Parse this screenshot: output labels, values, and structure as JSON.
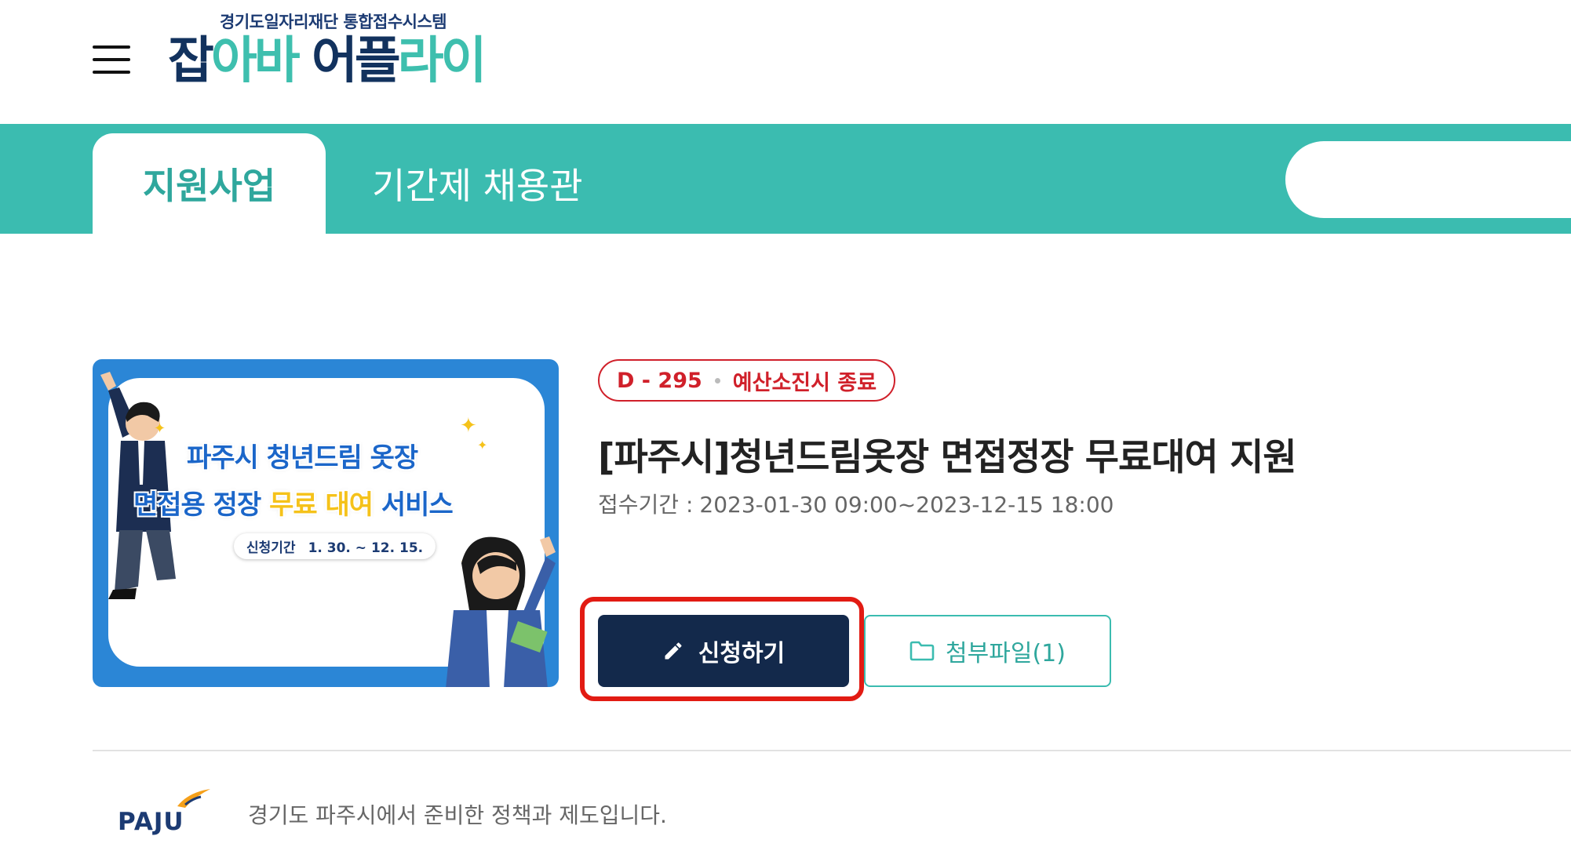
{
  "header": {
    "menu_icon": "hamburger-menu-icon",
    "logo_subtitle": "경기도일자리재단 통합접수시스템",
    "logo_part1": "잡",
    "logo_part2": "아바 ",
    "logo_part3": "어플",
    "logo_part4": "라이"
  },
  "nav": {
    "tabs": [
      {
        "label": "지원사업",
        "active": true
      },
      {
        "label": "기간제 채용관",
        "active": false
      }
    ]
  },
  "program": {
    "thumbnail": {
      "line1": "파주시 청년드림 옷장",
      "line2_a": "면접용 정장 ",
      "line2_b": "무료 대여",
      "line2_c": " 서비스",
      "period_label": "신청기간",
      "period_value": "1. 30. ~ 12. 15."
    },
    "badge_dday": "D - 295",
    "badge_note": "예산소진시 종료",
    "title": "[파주시]청년드림옷장 면접정장 무료대여 지원",
    "period_label": "접수기간 :",
    "period_value": "2023-01-30 09:00~2023-12-15 18:00",
    "apply_label": "신청하기",
    "apply_icon": "pencil-icon",
    "attach_label": "첨부파일(1)",
    "attach_icon": "folder-icon"
  },
  "footer": {
    "org_logo": "PAJU",
    "description": "경기도 파주시에서 준비한 정책과 제도입니다."
  },
  "colors": {
    "teal": "#3bbcb0",
    "navy": "#13294b",
    "red": "#d0202a",
    "highlight": "#e21b13"
  }
}
